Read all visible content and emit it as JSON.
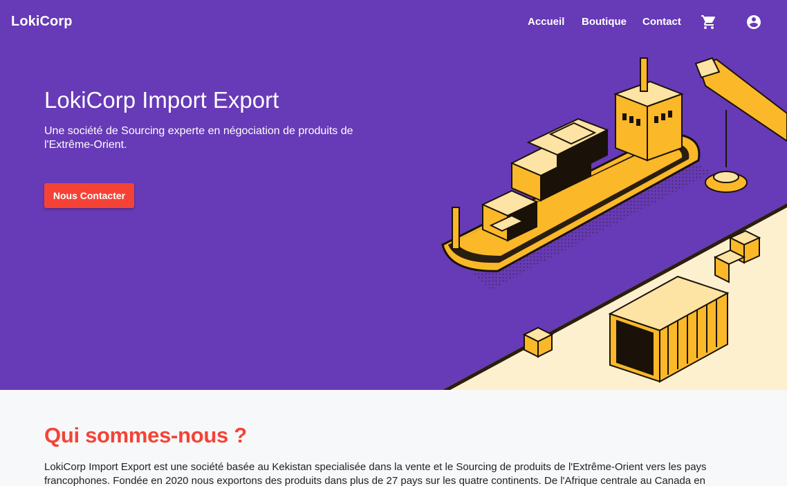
{
  "nav": {
    "brand": "LokiCorp",
    "links": [
      "Accueil",
      "Boutique",
      "Contact"
    ],
    "cart_icon": "cart-icon",
    "account_icon": "account-circle-icon"
  },
  "hero": {
    "title": "LokiCorp Import Export",
    "subtitle": "Une société de Sourcing experte en négociation de produits de l'Extrême-Orient.",
    "cta": "Nous Contacter",
    "illustration": "cargo-ship-port-illustration"
  },
  "about": {
    "title": "Qui sommes-nous ?",
    "text": "LokiCorp Import Export est une société basée au Kekistan specialisée dans la vente et le Sourcing de produits de l'Extrême-Orient vers les pays francophones. Fondée en 2020 nous exportons des produits dans plus de 27 pays sur les quatre continents. De l'Afrique centrale au Canada en passant"
  },
  "colors": {
    "primary": "#673ab7",
    "accent": "#f44336",
    "illustration_yellow": "#fbb829",
    "dock": "#fdf0cf"
  }
}
